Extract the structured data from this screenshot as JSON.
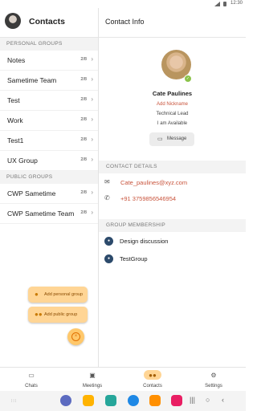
{
  "status_bar": {
    "time": "12:30"
  },
  "left_pane": {
    "title": "Contacts",
    "personal_groups_label": "PERSONAL GROUPS",
    "personal_groups": [
      {
        "name": "Notes",
        "count": "2/8"
      },
      {
        "name": "Sametime Team",
        "count": "2/8"
      },
      {
        "name": "Test",
        "count": "2/8"
      },
      {
        "name": "Work",
        "count": "2/8"
      },
      {
        "name": "Test1",
        "count": "2/8"
      },
      {
        "name": "UX Group",
        "count": "2/8"
      }
    ],
    "public_groups_label": "PUBLIC GROUPS",
    "public_groups": [
      {
        "name": "CWP Sametime",
        "count": "2/8"
      },
      {
        "name": "CWP Sametime Team",
        "count": "2/8"
      }
    ],
    "fab_menu": {
      "add_personal_group": "Add personal group",
      "add_public_group": "Add public group"
    }
  },
  "right_pane": {
    "title": "Contact Info",
    "contact": {
      "name": "Cate Paulines",
      "add_nickname": "Add Nickname",
      "role": "Technical Lead",
      "status": "I am Available",
      "message_button": "Message"
    },
    "contact_details_label": "CONTACT DETAILS",
    "email": "Cate_paulines@xyz.com",
    "phone": "+91 3759856546954",
    "group_membership_label": "GROUP MEMBERSHIP",
    "groups": [
      {
        "name": "Design discussion"
      },
      {
        "name": "TestGroup"
      }
    ]
  },
  "tab_bar": {
    "tabs": [
      {
        "label": "Chats",
        "icon": "chat-icon"
      },
      {
        "label": "Meetings",
        "icon": "meetings-icon"
      },
      {
        "label": "Contacts",
        "icon": "contacts-icon",
        "active": true
      },
      {
        "label": "Settings",
        "icon": "gear-icon"
      }
    ]
  },
  "colors": {
    "accent": "#ffd595",
    "link": "#c8533b",
    "presence": "#8bc34a",
    "group_icon": "#2c4a6b"
  }
}
